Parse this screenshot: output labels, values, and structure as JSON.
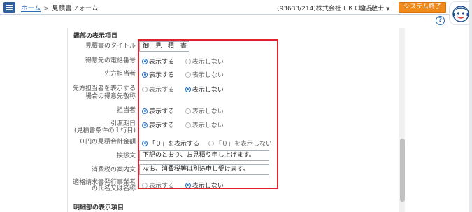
{
  "header": {
    "home": "ホーム",
    "separator": ">",
    "current": "見積書フォーム",
    "company": "(93633/214)株式会社ＴＫＣ食品",
    "user": "堤　敬士",
    "exit_label": "システム終了"
  },
  "help_label": "?",
  "section": {
    "title": "鑑部の表示項目",
    "footer_title": "明細部の表示項目"
  },
  "fields": {
    "title": {
      "label": "見積書のタイトル",
      "value": "御　見　積　書"
    },
    "phone": {
      "label": "得意先の電話番号",
      "opt_on": "表示する",
      "opt_off": "表示しない",
      "selected": "表示する"
    },
    "contact": {
      "label": "先方担当者",
      "opt_on": "表示する",
      "opt_off": "表示しない",
      "selected": "表示する"
    },
    "contact_honorific": {
      "label_line1": "先方担当者を表示する",
      "label_line2": "場合の得意先敬称",
      "opt_on": "表示する",
      "opt_off": "表示しない",
      "selected": "表示しない"
    },
    "staff": {
      "label": "担当者",
      "opt_on": "表示する",
      "opt_off": "表示しない",
      "selected": "表示する"
    },
    "delivery": {
      "label_line1": "引渡期日",
      "label_line2": "(見積書条件の１行目)",
      "opt_on": "表示する",
      "opt_off": "表示しない",
      "selected": "表示する"
    },
    "zero_total": {
      "label": "０円の見積合計金額",
      "opt_on": "「０」を表示する",
      "opt_off": "「０」を表示しない",
      "selected": "「０」を表示する"
    },
    "greeting": {
      "label": "挨拶文",
      "value": "下記のとおり、お見積り申し上げます。"
    },
    "tax_notice": {
      "label": "消費税の案内文",
      "value": "なお、消費税等は別途申し受けます。"
    },
    "invoice_issuer": {
      "label_line1": "適格請求書発行事業者",
      "label_line2": "の氏名又は名称",
      "opt_on": "表示する",
      "opt_off": "表示しない",
      "selected": "表示しない"
    }
  },
  "colors": {
    "accent": "#2c6bb5",
    "exit_button": "#f08a1c",
    "highlight_border": "#e0222c",
    "radio_selected": "#1f6fc8"
  }
}
